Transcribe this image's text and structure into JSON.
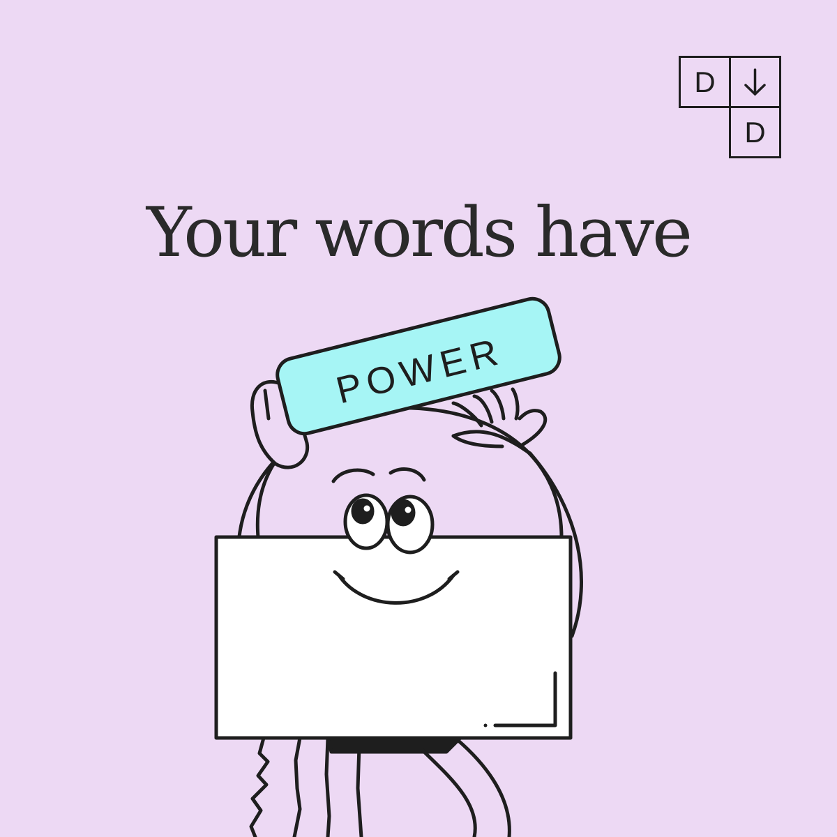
{
  "logo": {
    "top_left_letter": "D",
    "top_right_icon": "arrow-down-icon",
    "bottom_right_letter": "D"
  },
  "headline": {
    "text": "Your words have"
  },
  "sign": {
    "text": "POWER"
  },
  "colors": {
    "background": "#EDD9F4",
    "sign_fill": "#A6F5F5",
    "ink": "#1E1E1E",
    "body_fill": "#FFFFFF"
  }
}
